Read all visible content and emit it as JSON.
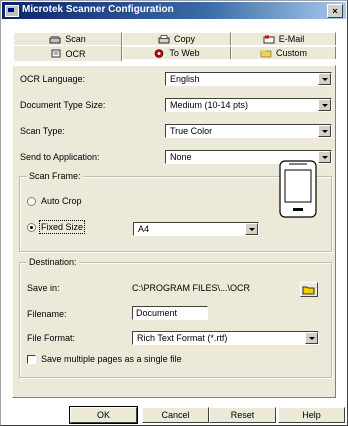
{
  "window": {
    "title": "Microtek Scanner Configuration",
    "close_glyph": "×"
  },
  "tabs": {
    "back_row": [
      {
        "label": "Scan",
        "icon": "scan-icon"
      },
      {
        "label": "Copy",
        "icon": "copy-icon"
      },
      {
        "label": "E-Mail",
        "icon": "email-icon"
      }
    ],
    "front_row": [
      {
        "label": "OCR",
        "icon": "ocr-icon",
        "active": true
      },
      {
        "label": "To Web",
        "icon": "web-icon"
      },
      {
        "label": "Custom",
        "icon": "custom-icon"
      }
    ]
  },
  "ocr": {
    "language_label": "OCR Language:",
    "language_value": "English",
    "doc_type_label": "Document Type Size:",
    "doc_type_value": "Medium (10-14 pts)",
    "scan_type_label": "Scan Type:",
    "scan_type_value": "True Color",
    "send_to_label": "Send to Application:",
    "send_to_value": "None"
  },
  "scan_frame": {
    "title": "Scan Frame:",
    "auto_crop_label": "Auto Crop",
    "auto_crop_checked": false,
    "fixed_size_label": "Fixed Size",
    "fixed_size_checked": true,
    "size_value": "A4"
  },
  "destination": {
    "title": "Destination:",
    "save_in_label": "Save in:",
    "save_in_value": "C:\\PROGRAM FILES\\...\\OCR",
    "filename_label": "Filename:",
    "filename_value": "Document",
    "file_format_label": "File Format:",
    "file_format_value": "Rich Text Format (*.rtf)",
    "multi_page_label": "Save multiple pages as a single file",
    "multi_page_checked": false
  },
  "buttons": {
    "ok": "OK",
    "cancel": "Cancel",
    "reset": "Reset",
    "help": "Help"
  }
}
